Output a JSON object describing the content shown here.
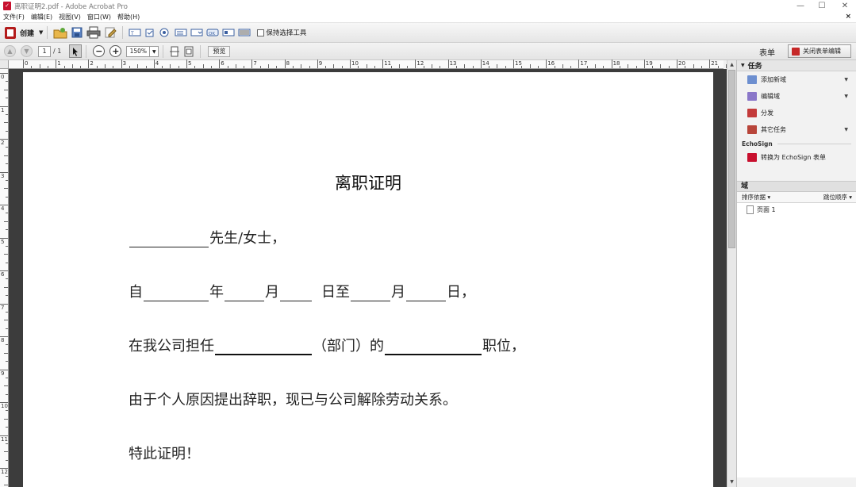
{
  "window": {
    "title": "离职证明2.pdf - Adobe Acrobat Pro",
    "controls": [
      "—",
      "☐",
      "✕"
    ]
  },
  "menu": {
    "items": [
      "文件(F)",
      "编辑(E)",
      "视图(V)",
      "窗口(W)",
      "帮助(H)"
    ],
    "close": "×"
  },
  "toolbar": {
    "create_label": "创建",
    "keep_select_label": "保持选择工具"
  },
  "nav": {
    "current_page": "1",
    "total_pages": "/ 1",
    "zoom": "150%",
    "preview_label": "预览"
  },
  "form": {
    "label": "表单",
    "close_edit_label": "关闭表单编辑"
  },
  "ruler": {
    "h": [
      "0",
      "1",
      "2",
      "3",
      "4",
      "5",
      "6",
      "7",
      "8",
      "9",
      "10",
      "11",
      "12",
      "13",
      "14",
      "15",
      "16",
      "17",
      "18",
      "19",
      "20",
      "21"
    ],
    "v": [
      "0",
      "1",
      "2",
      "3",
      "4",
      "5",
      "6",
      "7",
      "8",
      "9",
      "10",
      "11",
      "12"
    ]
  },
  "document": {
    "title": "离职证明",
    "line1_suffix": "先生/女士，",
    "line2": {
      "a": "自",
      "b": "年",
      "c": "月",
      "d": "日至",
      "e": "月",
      "f": "日，"
    },
    "line3": {
      "a": "在我公司担任",
      "b": "（部门）的",
      "c": "职位，"
    },
    "line4": "由于个人原因提出辞职，现已与公司解除劳动关系。",
    "line5": "特此证明！"
  },
  "tasks": {
    "header": "任务",
    "items": [
      "添加新域",
      "编辑域",
      "分发",
      "其它任务"
    ],
    "echosign_header": "EchoSign",
    "echosign_item": "转换为 EchoSign 表单"
  },
  "fields": {
    "header": "域",
    "sort_by": "排序依据 ▾",
    "tab_order": "跳位顺序 ▾",
    "page_item": "页面 1"
  },
  "colors": {
    "accent_red": "#c8102e",
    "doc_bg": "#3c3c3c"
  }
}
